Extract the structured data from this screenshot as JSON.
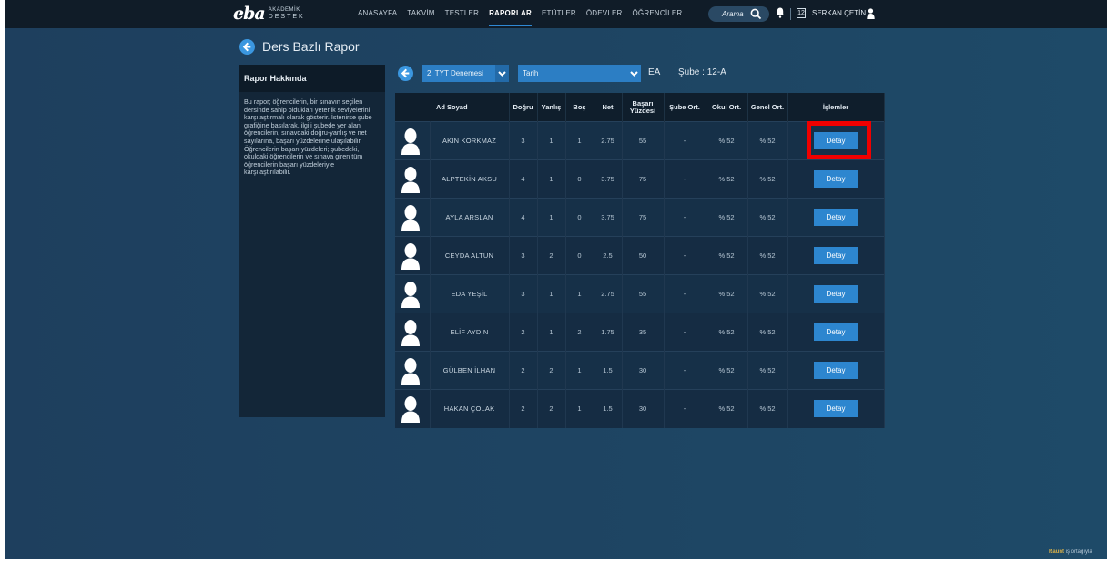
{
  "header": {
    "logo_main": "eba",
    "logo_sub_top": "AKADEMİK",
    "logo_sub_bottom": "DESTEK",
    "nav": [
      "ANASAYFA",
      "TAKVİM",
      "TESTLER",
      "RAPORLAR",
      "ETÜTLER",
      "ÖDEVLER",
      "ÖĞRENCİLER"
    ],
    "active_nav": "RAPORLAR",
    "search_label": "Arama",
    "calendar_day": "12",
    "user_name": "SERKAN ÇETİN"
  },
  "page": {
    "title": "Ders Bazlı Rapor"
  },
  "side_panel": {
    "heading": "Rapor Hakkında",
    "text": "Bu rapor; öğrencilerin, bir sınavın seçilen dersinde sahip oldukları yeterlik seviyelerini karşılaştırmalı olarak gösterir. İstenirse şube grafiğine basılarak, ilgili şubede yer alan öğrencilerin, sınavdaki doğru-yanlış ve net sayılarına, başarı yüzdelerine ulaşılabilir. Öğrencilerin başarı yüzdeleri; şubedeki, okuldaki öğrencilerin ve sınava giren tüm öğrencilerin başarı yüzdeleriyle karşılaştırılabilir."
  },
  "filters": {
    "exam": "2. TYT Denemesi",
    "date": "Tarih",
    "field": "EA",
    "branch": "Şube : 12-A"
  },
  "table": {
    "headers": [
      "Ad Soyad",
      "Doğru",
      "Yanlış",
      "Boş",
      "Net",
      "Başarı Yüzdesi",
      "Şube Ort.",
      "Okul Ort.",
      "Genel Ort.",
      "İşlemler"
    ],
    "button_label": "Detay",
    "rows": [
      {
        "name": "AKIN KORKMAZ",
        "dogru": "3",
        "yanlis": "1",
        "bos": "1",
        "net": "2.75",
        "basari": "55",
        "sube": "-",
        "okul": "% 52",
        "genel": "% 52"
      },
      {
        "name": "ALPTEKİN AKSU",
        "dogru": "4",
        "yanlis": "1",
        "bos": "0",
        "net": "3.75",
        "basari": "75",
        "sube": "-",
        "okul": "% 52",
        "genel": "% 52"
      },
      {
        "name": "AYLA ARSLAN",
        "dogru": "4",
        "yanlis": "1",
        "bos": "0",
        "net": "3.75",
        "basari": "75",
        "sube": "-",
        "okul": "% 52",
        "genel": "% 52"
      },
      {
        "name": "CEYDA ALTUN",
        "dogru": "3",
        "yanlis": "2",
        "bos": "0",
        "net": "2.5",
        "basari": "50",
        "sube": "-",
        "okul": "% 52",
        "genel": "% 52"
      },
      {
        "name": "EDA YEŞİL",
        "dogru": "3",
        "yanlis": "1",
        "bos": "1",
        "net": "2.75",
        "basari": "55",
        "sube": "-",
        "okul": "% 52",
        "genel": "% 52"
      },
      {
        "name": "ELİF AYDIN",
        "dogru": "2",
        "yanlis": "1",
        "bos": "2",
        "net": "1.75",
        "basari": "35",
        "sube": "-",
        "okul": "% 52",
        "genel": "% 52"
      },
      {
        "name": "GÜLBEN İLHAN",
        "dogru": "2",
        "yanlis": "2",
        "bos": "1",
        "net": "1.5",
        "basari": "30",
        "sube": "-",
        "okul": "% 52",
        "genel": "% 52"
      },
      {
        "name": "HAKAN ÇOLAK",
        "dogru": "2",
        "yanlis": "2",
        "bos": "1",
        "net": "1.5",
        "basari": "30",
        "sube": "-",
        "okul": "% 52",
        "genel": "% 52"
      }
    ]
  },
  "footer": {
    "brand": "Raunt",
    "tag": "iş ortağıyla"
  },
  "colors": {
    "accent": "#2d86cf",
    "highlight": "#f00000"
  }
}
